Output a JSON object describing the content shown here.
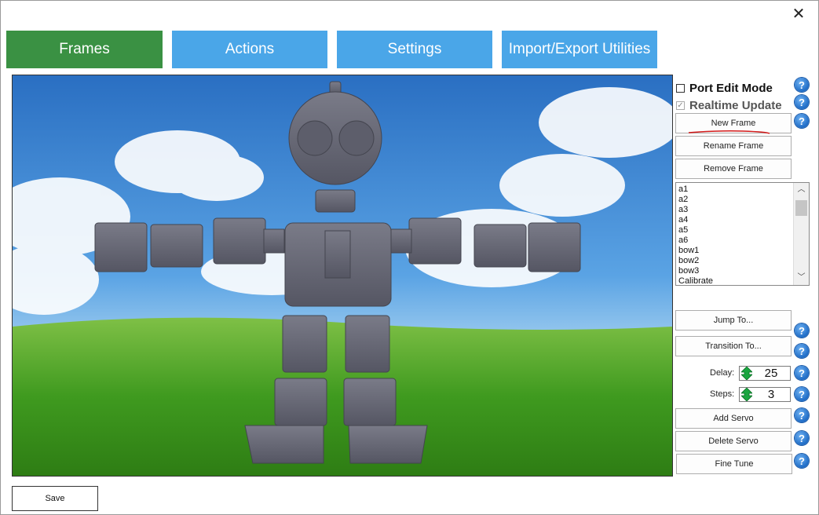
{
  "window": {
    "close_symbol": "✕"
  },
  "tabs": [
    {
      "label": "Frames",
      "active": true
    },
    {
      "label": "Actions",
      "active": false
    },
    {
      "label": "Settings",
      "active": false
    },
    {
      "label": "Import/Export Utilities",
      "active": false
    }
  ],
  "side": {
    "port_edit_mode": {
      "label": "Port Edit Mode",
      "checked": false
    },
    "realtime_update": {
      "label": "Realtime Update",
      "checked": true,
      "enabled": false
    },
    "new_frame": "New Frame",
    "rename_frame": "Rename Frame",
    "remove_frame": "Remove Frame",
    "frames": [
      "a1",
      "a2",
      "a3",
      "a4",
      "a5",
      "a6",
      "bow1",
      "bow2",
      "bow3",
      "Calibrate"
    ],
    "jump_to": "Jump To...",
    "transition_to": "Transition To...",
    "delay_label": "Delay:",
    "delay_value": "25",
    "steps_label": "Steps:",
    "steps_value": "3",
    "add_servo": "Add Servo",
    "delete_servo": "Delete Servo",
    "fine_tune": "Fine Tune",
    "help_glyph": "?"
  },
  "footer": {
    "save": "Save"
  },
  "colors": {
    "active_tab": "#3a9143",
    "inactive_tab": "#4aa6e8",
    "help_blue": "#1f6cc6",
    "spin_green": "#1aa640"
  }
}
